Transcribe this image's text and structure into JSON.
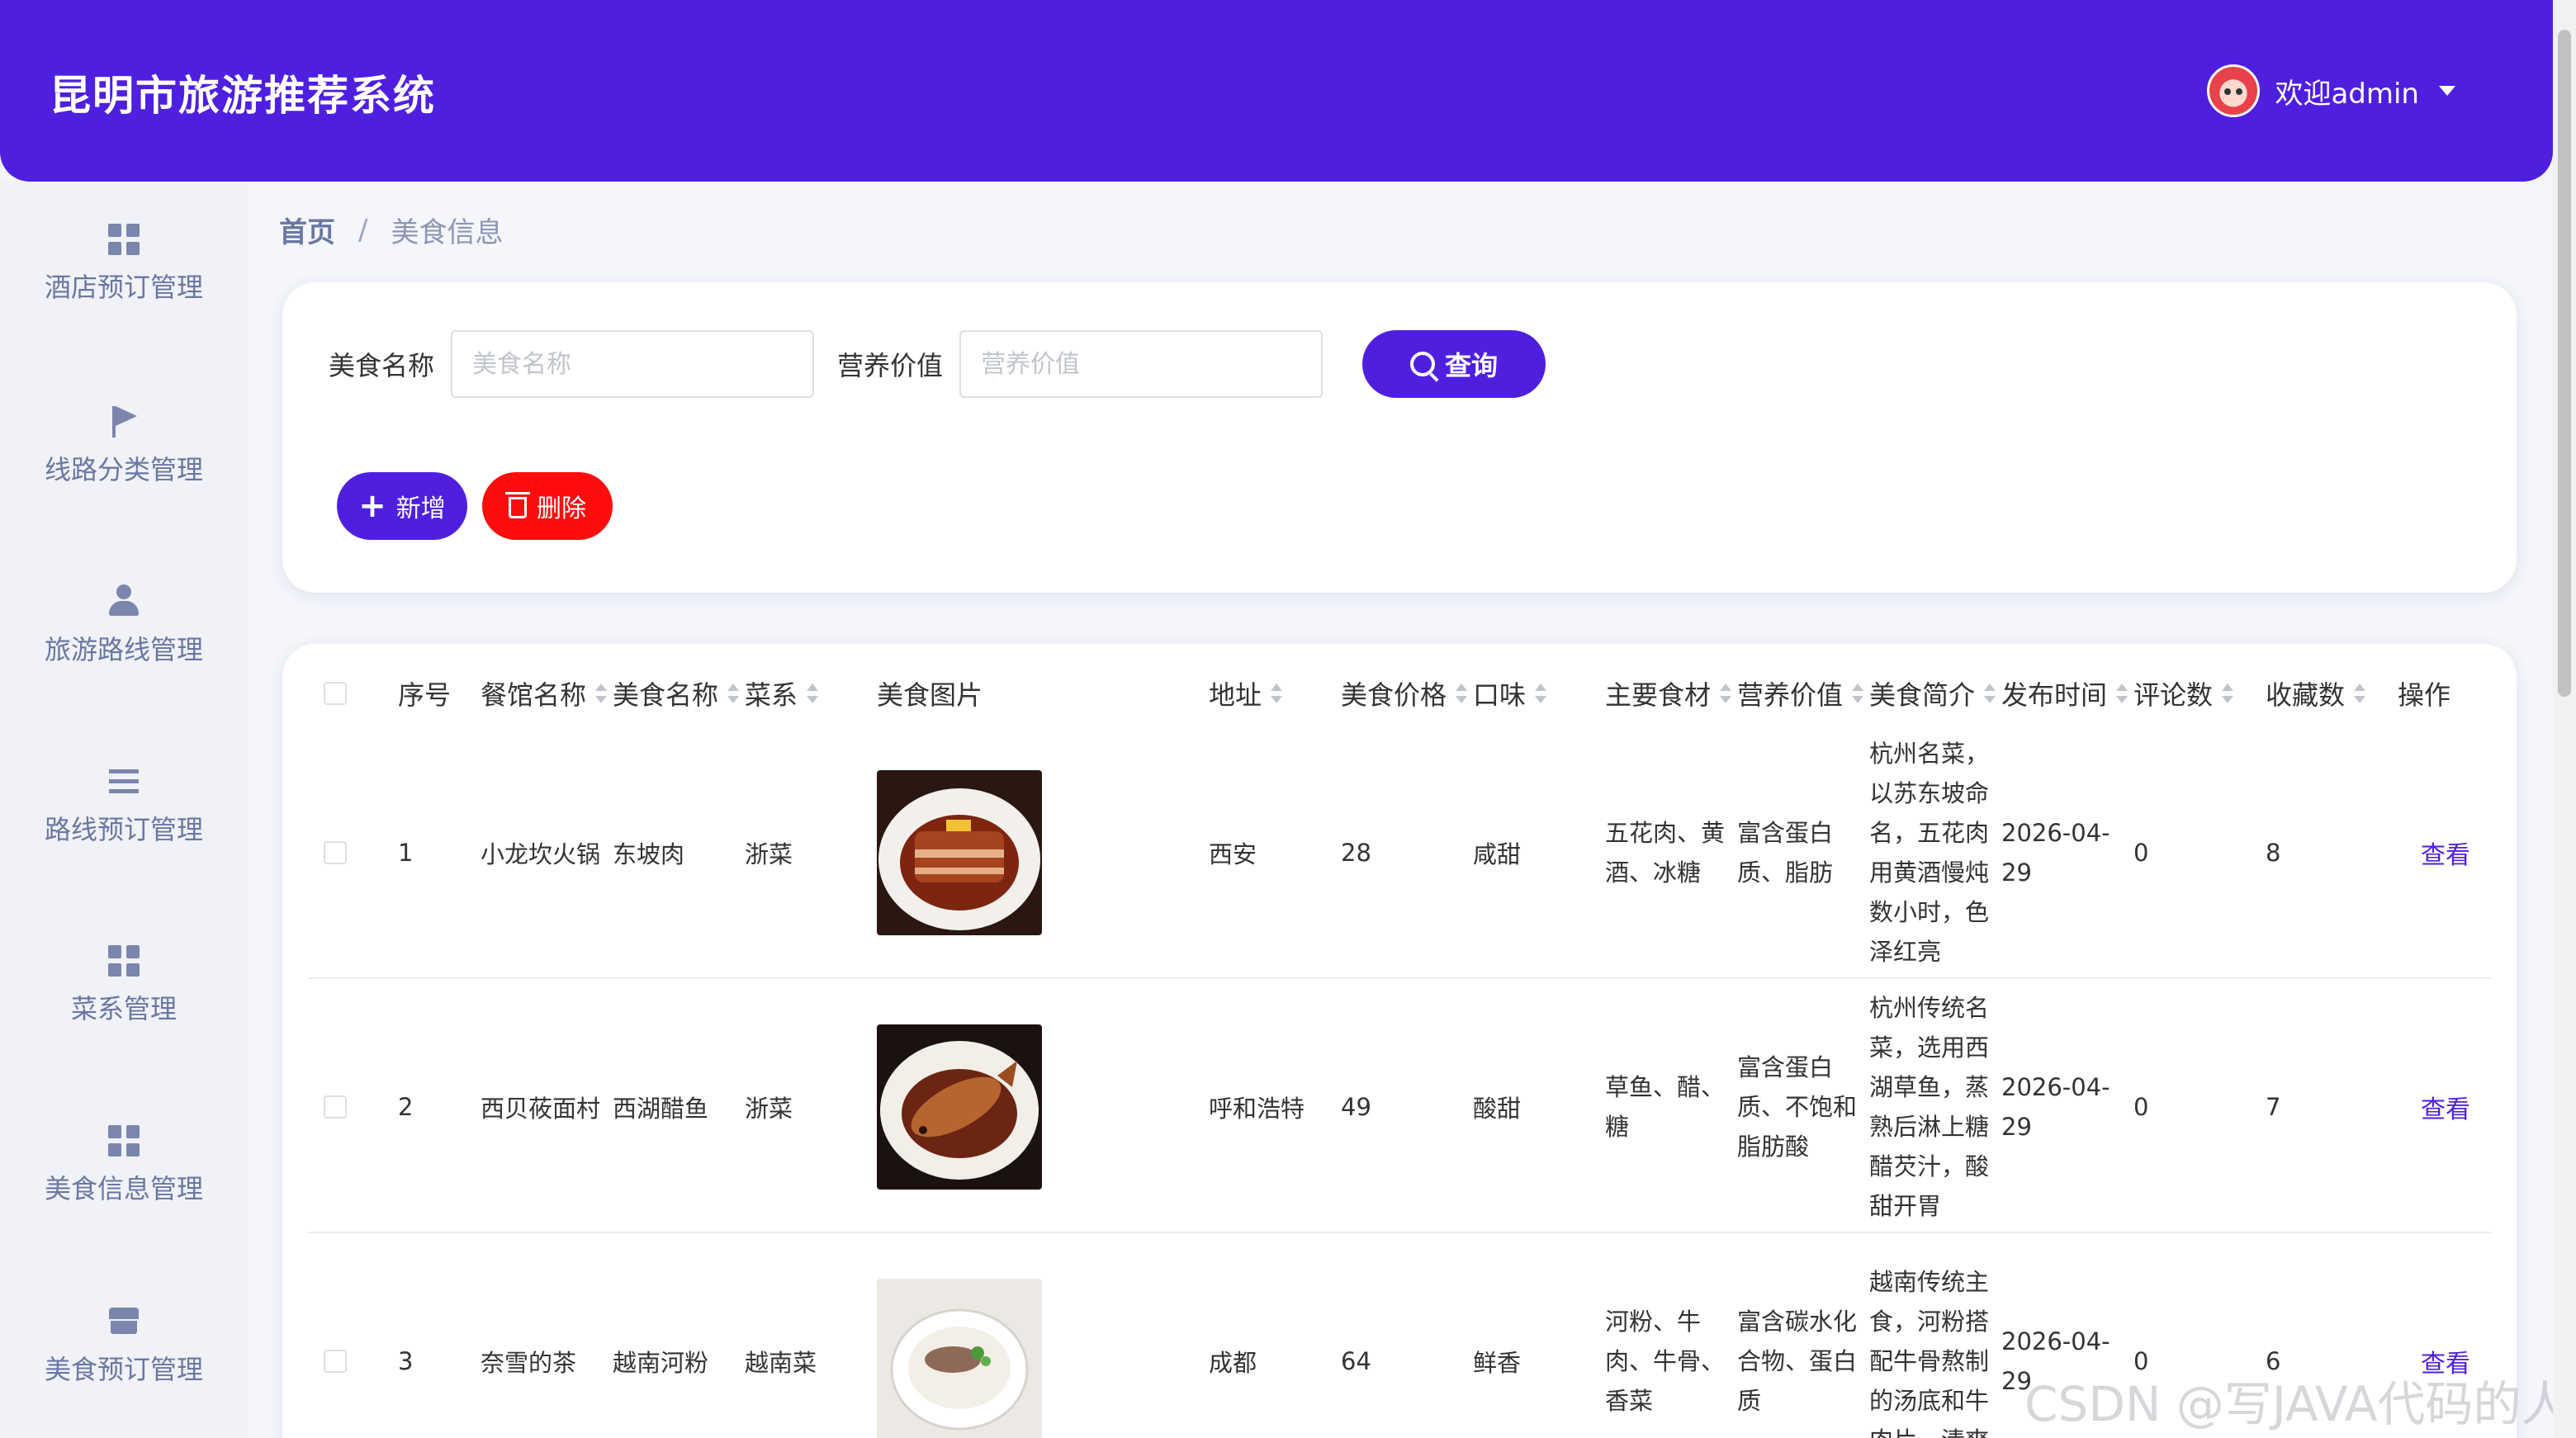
{
  "header": {
    "title": "昆明市旅游推荐系统",
    "welcome": "欢迎admin"
  },
  "sidebar": {
    "items": [
      {
        "label": "酒店预订管理",
        "icon": "grid-icon"
      },
      {
        "label": "线路分类管理",
        "icon": "flag-icon"
      },
      {
        "label": "旅游路线管理",
        "icon": "user-icon"
      },
      {
        "label": "路线预订管理",
        "icon": "list-icon"
      },
      {
        "label": "菜系管理",
        "icon": "grid-icon"
      },
      {
        "label": "美食信息管理",
        "icon": "grid-icon"
      },
      {
        "label": "美食预订管理",
        "icon": "shop-icon"
      }
    ]
  },
  "breadcrumb": {
    "home": "首页",
    "separator": "/",
    "current": "美食信息"
  },
  "search": {
    "name_label": "美食名称",
    "name_placeholder": "美食名称",
    "nutrition_label": "营养价值",
    "nutrition_placeholder": "营养价值",
    "query_label": "查询",
    "add_label": "新增",
    "delete_label": "删除"
  },
  "table": {
    "headers": {
      "index": "序号",
      "restaurant": "餐馆名称",
      "food": "美食名称",
      "cuisine": "菜系",
      "image": "美食图片",
      "address": "地址",
      "price": "美食价格",
      "taste": "口味",
      "ingredients": "主要食材",
      "nutrition": "营养价值",
      "intro": "美食简介",
      "published": "发布时间",
      "comments": "评论数",
      "favorites": "收藏数",
      "actions": "操作"
    },
    "rows": [
      {
        "index": "1",
        "restaurant": "小龙坎火锅",
        "food": "东坡肉",
        "cuisine": "浙菜",
        "address": "西安",
        "price": "28",
        "taste": "咸甜",
        "ingredients": "五花肉、黄酒、冰糖",
        "nutrition": "富含蛋白质、脂肪",
        "intro": "杭州名菜，以苏东坡命名，五花肉用黄酒慢炖数小时，色泽红亮",
        "published": "2026-04-29",
        "comments": "0",
        "favorites": "8",
        "action": "查看"
      },
      {
        "index": "2",
        "restaurant": "西贝莜面村",
        "food": "西湖醋鱼",
        "cuisine": "浙菜",
        "address": "呼和浩特",
        "price": "49",
        "taste": "酸甜",
        "ingredients": "草鱼、醋、糖",
        "nutrition": "富含蛋白质、不饱和脂肪酸",
        "intro": "杭州传统名菜，选用西湖草鱼，蒸熟后淋上糖醋芡汁，酸甜开胃",
        "published": "2026-04-29",
        "comments": "0",
        "favorites": "7",
        "action": "查看"
      },
      {
        "index": "3",
        "restaurant": "奈雪的茶",
        "food": "越南河粉",
        "cuisine": "越南菜",
        "address": "成都",
        "price": "64",
        "taste": "鲜香",
        "ingredients": "河粉、牛肉、牛骨、香菜",
        "nutrition": "富含碳水化合物、蛋白质",
        "intro": "越南传统主食，河粉搭配牛骨熬制的汤底和牛肉片，清爽",
        "published": "2026-04-29",
        "comments": "0",
        "favorites": "6",
        "action": "查看"
      }
    ]
  },
  "watermark": "CSDN @写JAVA代码的人",
  "colors": {
    "primary": "#4f1fe0",
    "danger": "#ff0c0c",
    "sidebar_text": "#6a77a3"
  }
}
